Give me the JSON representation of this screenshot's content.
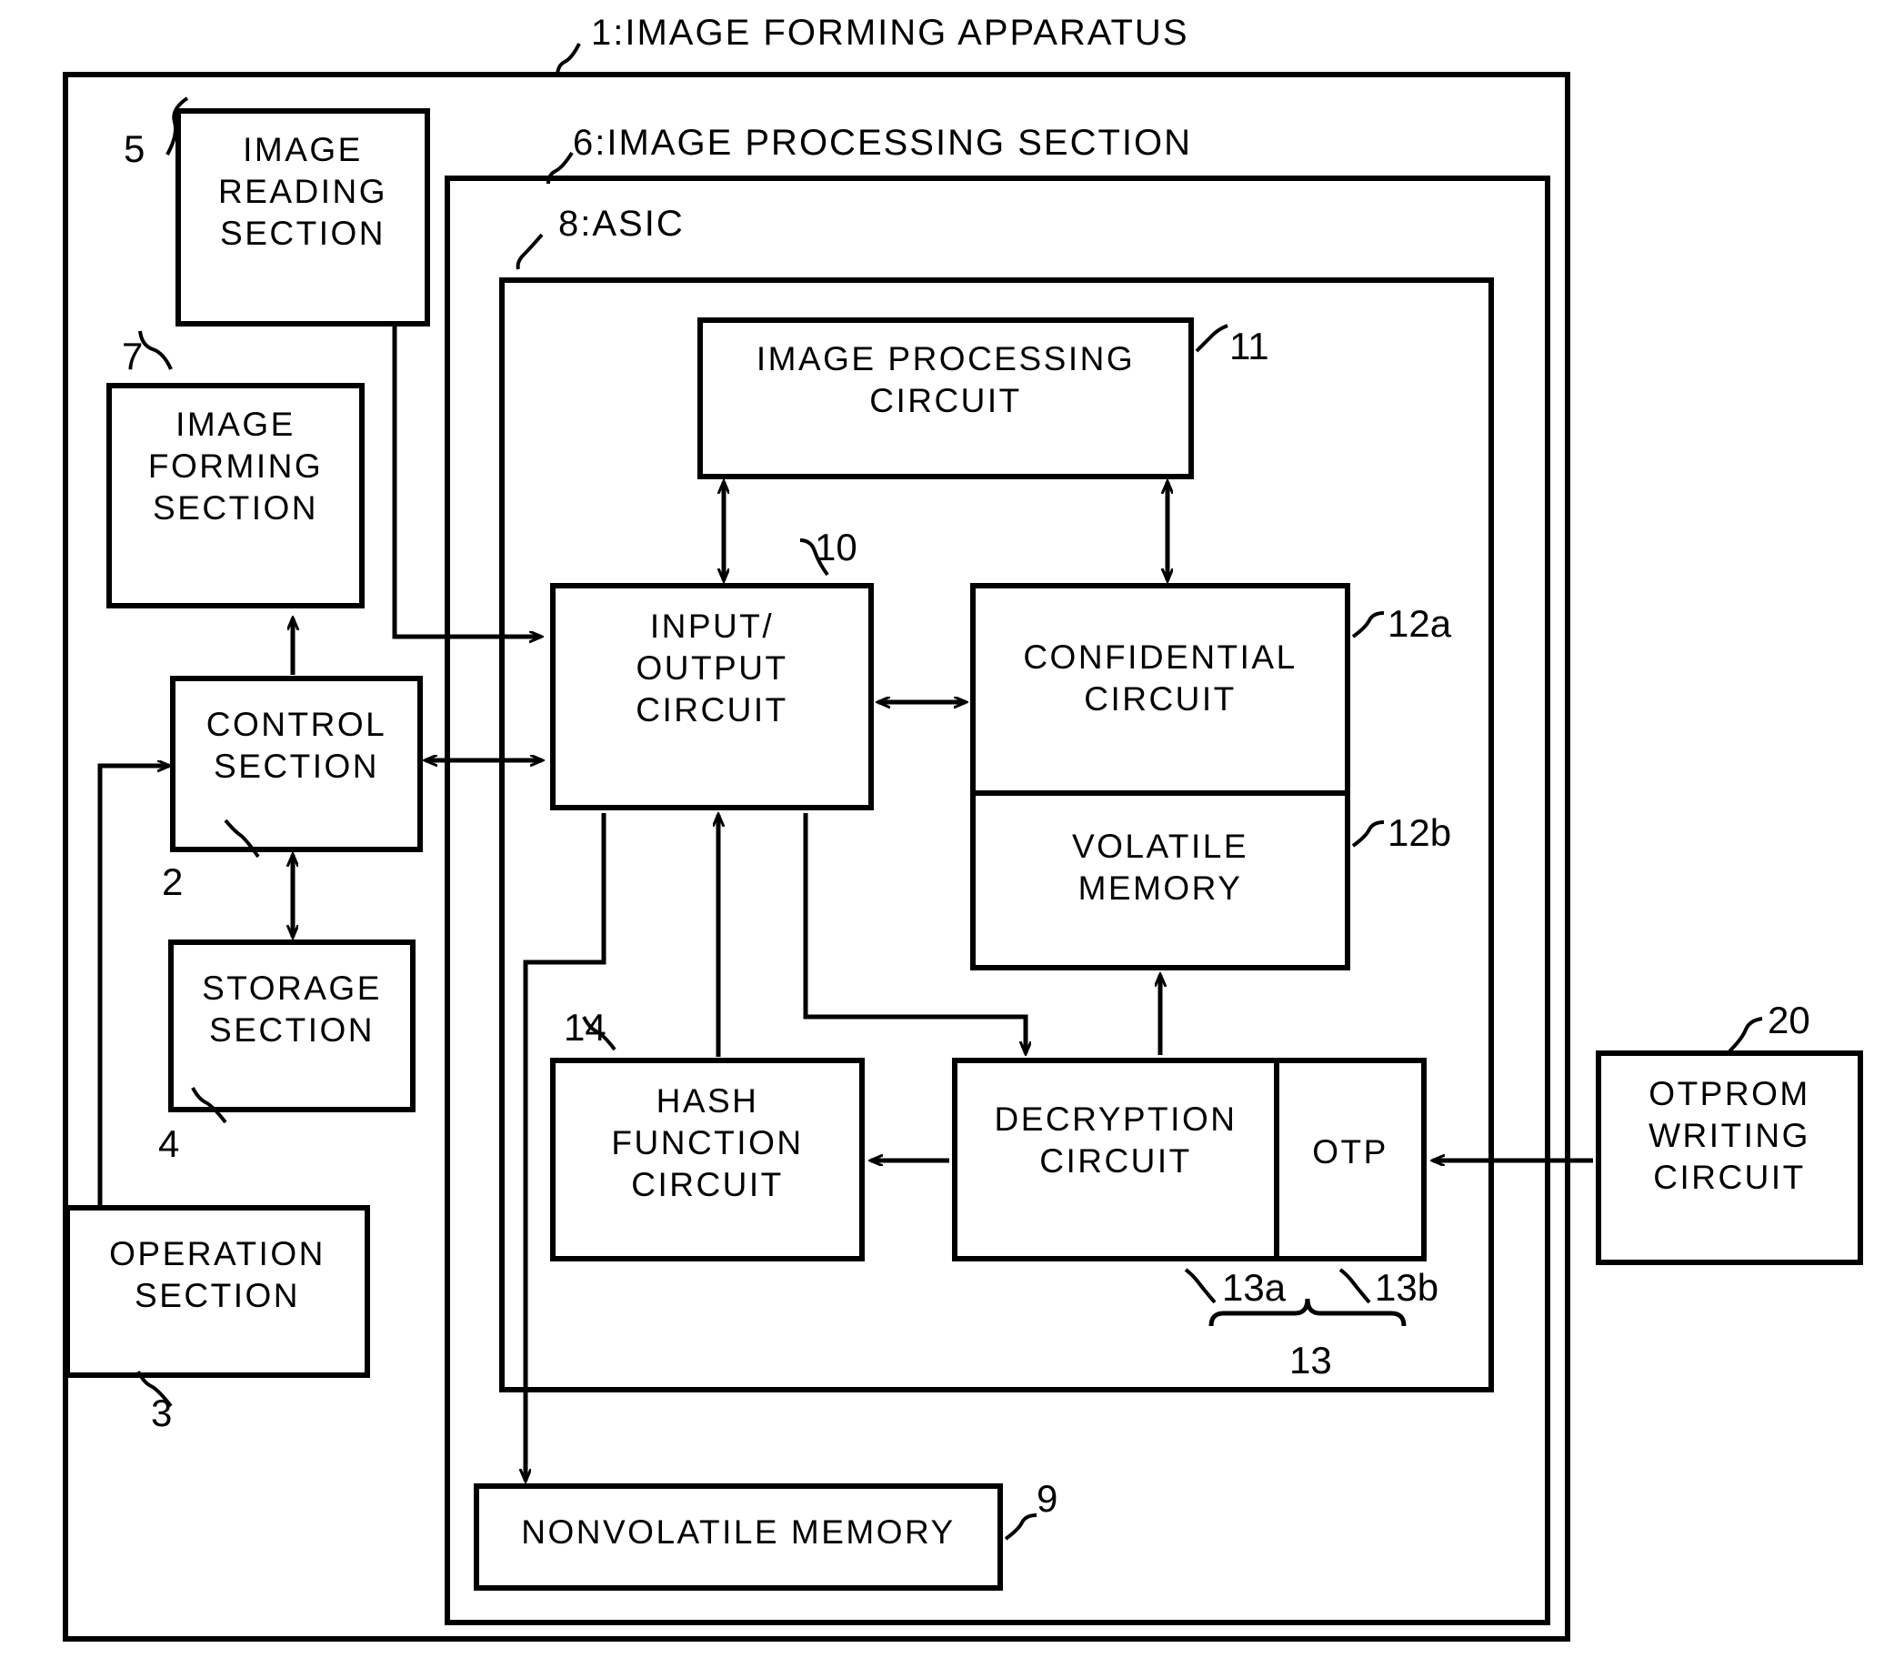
{
  "figure": {
    "type": "patent-block-diagram",
    "outer_title": "1:IMAGE FORMING APPARATUS",
    "processing_title": "6:IMAGE PROCESSING SECTION",
    "asic_title": "8:ASIC"
  },
  "blocks": {
    "image_reading_section": {
      "label": "IMAGE\nREADING\nSECTION",
      "ref": "5"
    },
    "image_forming_section": {
      "label": "IMAGE\nFORMING\nSECTION",
      "ref": "7"
    },
    "control_section": {
      "label": "CONTROL\nSECTION",
      "ref": "2"
    },
    "storage_section": {
      "label": "STORAGE\nSECTION",
      "ref": "4"
    },
    "operation_section": {
      "label": "OPERATION\nSECTION",
      "ref": "3"
    },
    "image_processing_circuit": {
      "label": "IMAGE PROCESSING\nCIRCUIT",
      "ref": "11"
    },
    "input_output_circuit": {
      "label": "INPUT/\nOUTPUT\nCIRCUIT",
      "ref": "10"
    },
    "confidential_circuit": {
      "label": "CONFIDENTIAL\nCIRCUIT",
      "ref": "12a"
    },
    "volatile_memory": {
      "label": "VOLATILE\nMEMORY",
      "ref": "12b"
    },
    "hash_function_circuit": {
      "label": "HASH\nFUNCTION\nCIRCUIT",
      "ref": "14"
    },
    "decryption_circuit": {
      "label": "DECRYPTION\nCIRCUIT",
      "ref": "13a"
    },
    "otp": {
      "label": "OTP",
      "ref": "13b"
    },
    "decryption_group": {
      "ref": "13"
    },
    "nonvolatile_memory": {
      "label": "NONVOLATILE MEMORY",
      "ref": "9"
    },
    "otprom_writing_circuit": {
      "label": "OTPROM\nWRITING\nCIRCUIT",
      "ref": "20"
    }
  },
  "colors": {
    "line": "#000000",
    "background": "#ffffff"
  }
}
